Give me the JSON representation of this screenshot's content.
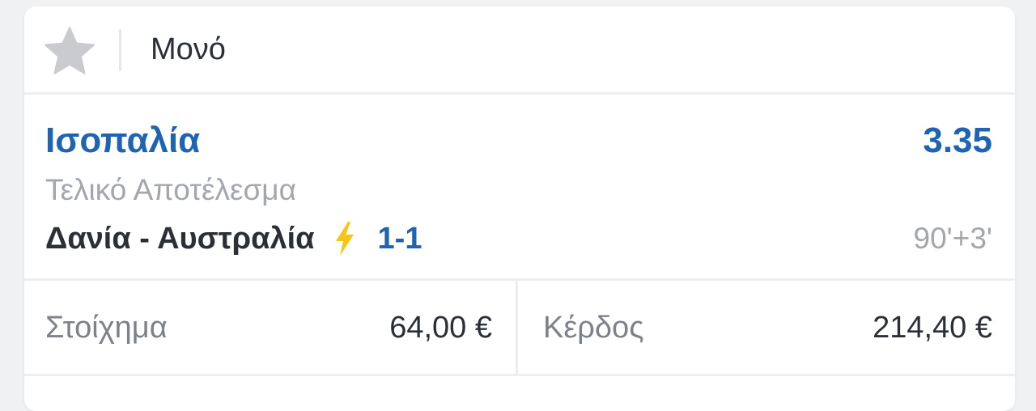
{
  "header": {
    "bet_type": "Μονό",
    "favorite_icon": "star-icon"
  },
  "selection": {
    "name": "Ισοπαλία",
    "odds": "3.35",
    "market": "Τελικό Αποτέλεσμα"
  },
  "match": {
    "teams": "Δανία - Αυστραλία",
    "live_icon": "lightning-bolt-icon",
    "score": "1-1",
    "time": "90'+3'"
  },
  "footer": {
    "stake_label": "Στοίχημα",
    "stake_value": "64,00 €",
    "win_label": "Κέρδος",
    "win_value": "214,40 €"
  },
  "colors": {
    "accent_blue": "#1f63b3",
    "muted_gray": "#a3a7ad",
    "bolt_yellow": "#f5c518",
    "star_gray": "#c9cbcf"
  }
}
